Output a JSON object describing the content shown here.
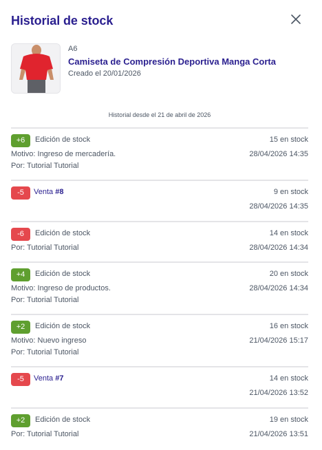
{
  "header": {
    "title": "Historial de stock"
  },
  "product": {
    "sku": "A6",
    "name": "Camiseta de Compresión Deportiva Manga Corta",
    "created": "Creado el 20/01/2026"
  },
  "history_since": "Historial desde el 21 de abril de 2026",
  "entries": [
    {
      "badge": "+6",
      "type": "Edición de stock",
      "stock": "15 en stock",
      "reason": "Motivo: Ingreso de mercadería.",
      "date": "28/04/2026 14:35",
      "by": "Por: Tutorial Tutorial"
    },
    {
      "badge": "-5",
      "sale_prefix": "Venta ",
      "sale_ref": "#8",
      "stock": "9 en stock",
      "date": "28/04/2026 14:35"
    },
    {
      "badge": "-6",
      "type": "Edición de stock",
      "stock": "14 en stock",
      "by": "Por: Tutorial Tutorial",
      "date": "28/04/2026 14:34"
    },
    {
      "badge": "+4",
      "type": "Edición de stock",
      "stock": "20 en stock",
      "reason": "Motivo: Ingreso de productos.",
      "date": "28/04/2026 14:34",
      "by": "Por: Tutorial Tutorial"
    },
    {
      "badge": "+2",
      "type": "Edición de stock",
      "stock": "16 en stock",
      "reason": "Motivo: Nuevo ingreso",
      "date": "21/04/2026 15:17",
      "by": "Por: Tutorial Tutorial"
    },
    {
      "badge": "-5",
      "sale_prefix": "Venta ",
      "sale_ref": "#7",
      "stock": "14 en stock",
      "date": "21/04/2026 13:52"
    },
    {
      "badge": "+2",
      "type": "Edición de stock",
      "stock": "19 en stock",
      "by": "Por: Tutorial Tutorial",
      "date": "21/04/2026 13:51"
    }
  ],
  "colors": {
    "accent": "#2a1f8f",
    "positive_badge": "#5f9f2f",
    "negative_badge": "#e5484d",
    "divider": "#e4e4e7"
  },
  "icons": {
    "close": "close-icon"
  }
}
